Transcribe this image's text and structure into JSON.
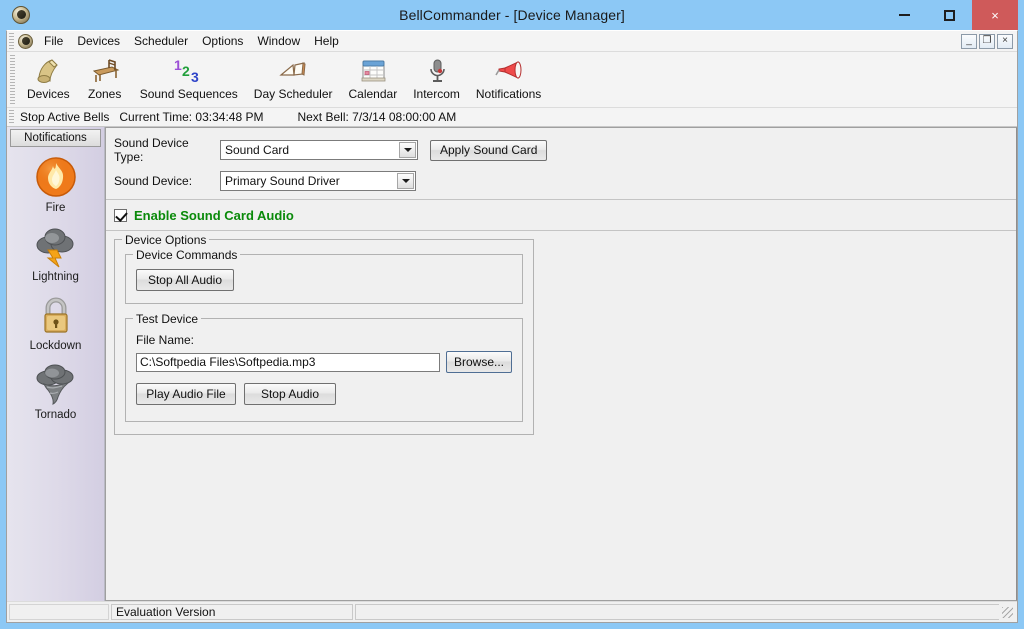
{
  "window": {
    "title": "BellCommander - [Device Manager]",
    "app_icon": "bell-app-icon",
    "minimize_label": "minimize",
    "maximize_label": "maximize",
    "close_label": "×",
    "titlebar_color": "#8cc8f5",
    "close_color": "#cf5a5a"
  },
  "mdi": {
    "minimize": "_",
    "restore": "❐",
    "close": "×"
  },
  "menu": {
    "items": [
      {
        "label": "File"
      },
      {
        "label": "Devices"
      },
      {
        "label": "Scheduler"
      },
      {
        "label": "Options"
      },
      {
        "label": "Window"
      },
      {
        "label": "Help"
      }
    ]
  },
  "toolbar": {
    "items": [
      {
        "label": "Devices",
        "icon": "bell-icon"
      },
      {
        "label": "Zones",
        "icon": "desk-icon"
      },
      {
        "label": "Sound Sequences",
        "icon": "numbers-123-icon"
      },
      {
        "label": "Day Scheduler",
        "icon": "open-book-icon"
      },
      {
        "label": "Calendar",
        "icon": "calendar-icon"
      },
      {
        "label": "Intercom",
        "icon": "microphone-icon"
      },
      {
        "label": "Notifications",
        "icon": "megaphone-icon"
      }
    ]
  },
  "info_bar": {
    "stop_active_bells": "Stop Active Bells",
    "current_time": "Current Time: 03:34:48 PM",
    "next_bell": "Next Bell: 7/3/14 08:00:00 AM"
  },
  "sidebar": {
    "header": "Notifications",
    "items": [
      {
        "label": "Fire",
        "icon": "fire-icon"
      },
      {
        "label": "Lightning",
        "icon": "lightning-cloud-icon"
      },
      {
        "label": "Lockdown",
        "icon": "padlock-icon"
      },
      {
        "label": "Tornado",
        "icon": "tornado-icon"
      }
    ]
  },
  "device_manager": {
    "sound_device_type_label": "Sound Device Type:",
    "sound_device_type_value": "Sound Card",
    "sound_device_label": "Sound Device:",
    "sound_device_value": "Primary Sound Driver",
    "apply_button": "Apply Sound Card",
    "enable_checkbox_label": "Enable Sound Card Audio",
    "enable_checkbox_checked": true,
    "enable_label_color": "#0a8a0a",
    "device_options_title": "Device Options",
    "device_commands_title": "Device Commands",
    "stop_all_audio_button": "Stop All Audio",
    "test_device_title": "Test Device",
    "file_name_label": "File Name:",
    "file_name_value": "C:\\Softpedia Files\\Softpedia.mp3",
    "file_name_placeholder": "",
    "browse_button": "Browse...",
    "play_audio_button": "Play Audio File",
    "stop_audio_button": "Stop Audio"
  },
  "status_bar": {
    "panel1": "",
    "panel2": "Evaluation Version",
    "panel3": ""
  }
}
